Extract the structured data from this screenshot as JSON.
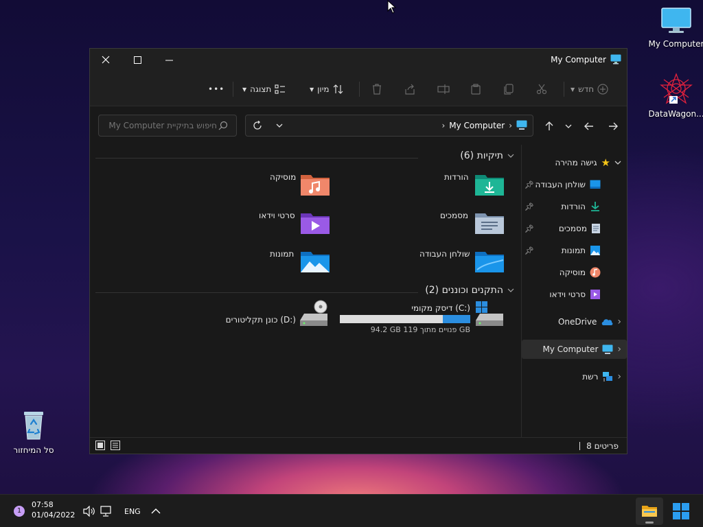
{
  "desktop": {
    "icons": [
      {
        "label": "My Computer"
      },
      {
        "label": "DataWagon..."
      },
      {
        "label": "סל המיחזור"
      }
    ]
  },
  "window": {
    "title": "My Computer",
    "toolbar": {
      "new_label": "חדש",
      "sort_label": "מיון",
      "view_label": "תצוגה",
      "more_label": "•••"
    },
    "address": {
      "crumb": "My Computer"
    },
    "search": {
      "placeholder": "חיפוש בתיקיית My Computer"
    },
    "sidebar": {
      "quick_access": "גישה מהירה",
      "items": [
        {
          "label": "שולחן העבודה"
        },
        {
          "label": "הורדות"
        },
        {
          "label": "מסמכים"
        },
        {
          "label": "תמונות"
        },
        {
          "label": "מוסיקה"
        },
        {
          "label": "סרטי וידאו"
        }
      ],
      "onedrive": "OneDrive",
      "my_computer": "My Computer",
      "network": "רשת"
    },
    "folders_group": "תיקיות (6)",
    "folders": [
      {
        "label": "הורדות"
      },
      {
        "label": "מוסיקה"
      },
      {
        "label": "מסמכים"
      },
      {
        "label": "סרטי וידאו"
      },
      {
        "label": "שולחן העבודה"
      },
      {
        "label": "תמונות"
      }
    ],
    "devices_group": "התקנים וכוננים (2)",
    "drives": {
      "c_label": "דיסק מקומי (C:)",
      "c_space": "94.2 GB פנויים מתוך 119 GB",
      "c_used_fraction": 0.21,
      "d_label": "כונן תקליטורים (D:)"
    },
    "status": "8 פריטים"
  },
  "taskbar": {
    "lang": "ENG",
    "time": "07:58",
    "date": "01/04/2022",
    "notif_count": "1"
  },
  "colors": {
    "accent": "#2b8ee0",
    "folder_teal": "#18a58a",
    "folder_orange": "#e8744f",
    "folder_purple": "#8a4fd6",
    "folder_blue": "#1a8fe0"
  }
}
